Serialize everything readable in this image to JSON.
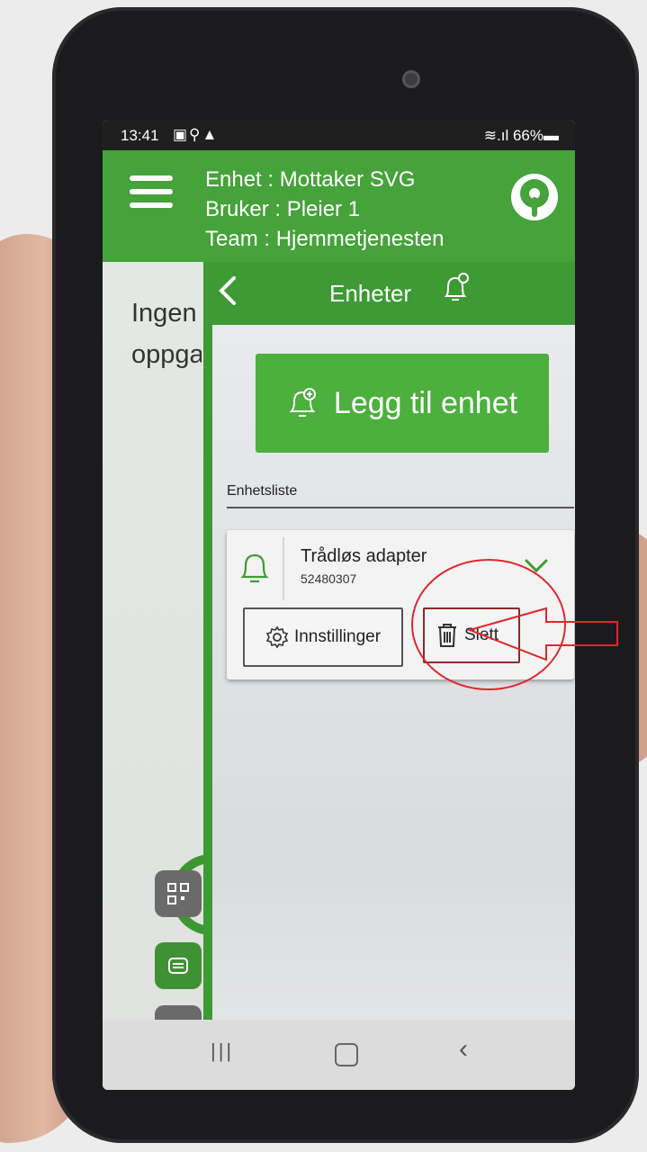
{
  "status_bar": {
    "time": "13:41",
    "icons": "▣⚲▲",
    "right": "≋.ıl 66%▬"
  },
  "app_header": {
    "unit_line": "Enhet : Mottaker SVG",
    "user_line": "Bruker : Pleier 1",
    "team_line": "Team : Hjemmetjenesten",
    "brand_color": "#46a23a"
  },
  "background_screen": {
    "empty_text_line1": "Ingen",
    "empty_text_line2": "oppgaver",
    "side_buttons": [
      "qr-icon",
      "list-icon",
      "team-icon",
      "logo-icon"
    ]
  },
  "panel": {
    "title": "Enheter",
    "add_button_label": "Legg til enhet",
    "list_label": "Enhetsliste",
    "device": {
      "name": "Trådløs adapter",
      "id": "52480307",
      "settings_label": "Innstillinger",
      "delete_label": "Slett"
    }
  },
  "annotation_color": "#e0262c"
}
